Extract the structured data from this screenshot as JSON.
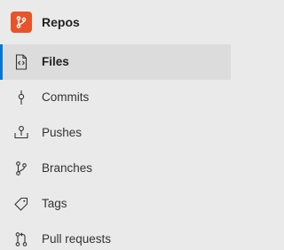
{
  "header": {
    "title": "Repos",
    "icon": "repos-icon",
    "accent_color": "#e8542a"
  },
  "nav": {
    "selected_index": 0,
    "accent_color": "#0078d4",
    "items": [
      {
        "label": "Files",
        "icon": "file-code-icon"
      },
      {
        "label": "Commits",
        "icon": "commit-icon"
      },
      {
        "label": "Pushes",
        "icon": "push-icon"
      },
      {
        "label": "Branches",
        "icon": "branch-icon"
      },
      {
        "label": "Tags",
        "icon": "tag-icon"
      },
      {
        "label": "Pull requests",
        "icon": "pull-request-icon"
      }
    ]
  }
}
